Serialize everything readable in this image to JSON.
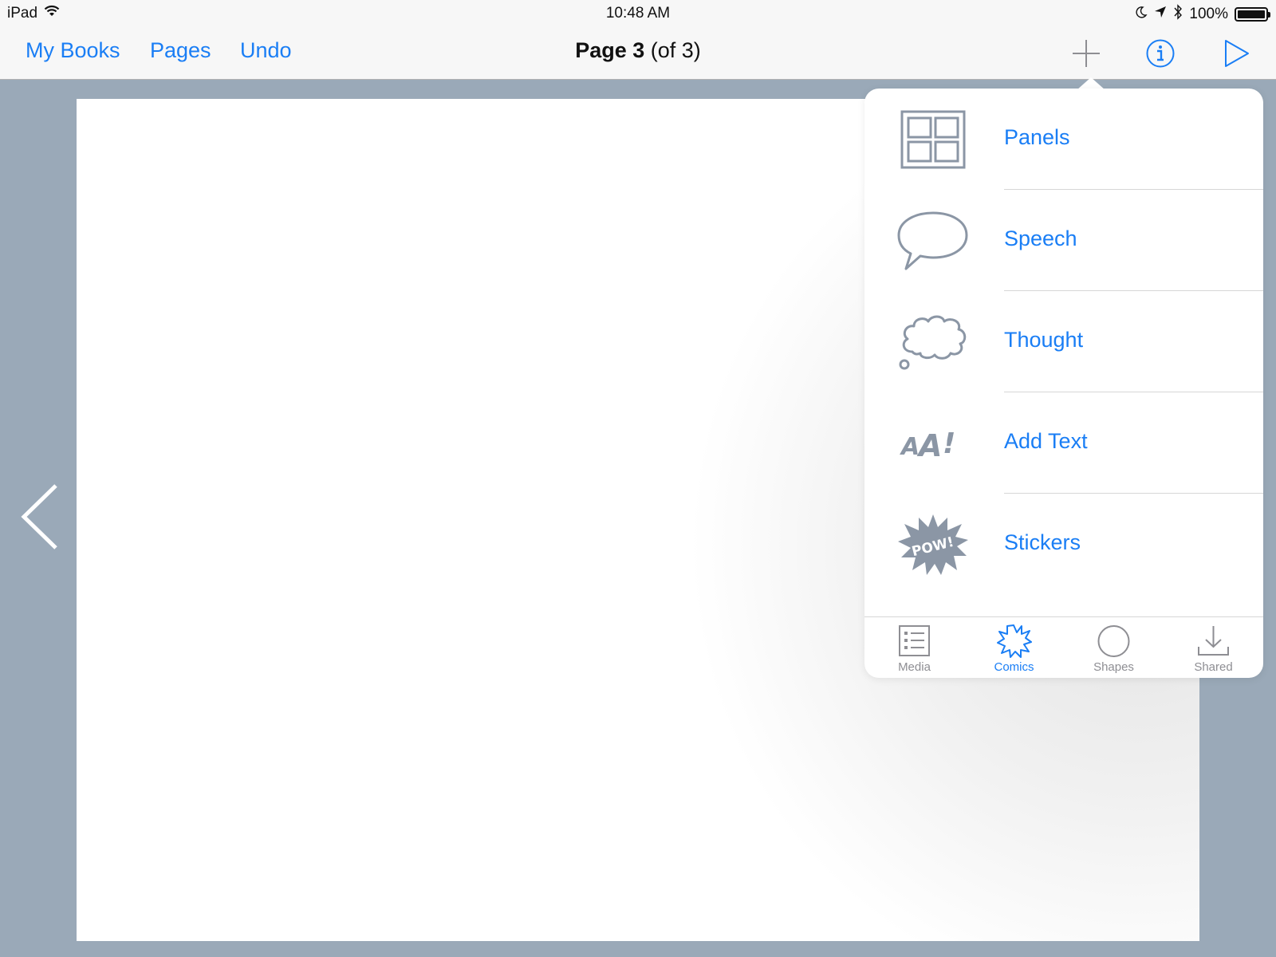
{
  "status_bar": {
    "device": "iPad",
    "time": "10:48 AM",
    "battery": "100%",
    "battery_level": 1.0,
    "icons": [
      "wifi-icon",
      "moon-icon",
      "location-arrow-icon",
      "bluetooth-icon",
      "battery-icon"
    ]
  },
  "nav": {
    "my_books": "My Books",
    "pages": "Pages",
    "undo": "Undo",
    "title_bold": "Page 3",
    "title_rest": " (of 3)",
    "icons": [
      "add-icon",
      "info-icon",
      "play-icon"
    ]
  },
  "popover": {
    "items": [
      {
        "label": "Panels",
        "icon": "panels-icon"
      },
      {
        "label": "Speech",
        "icon": "speech-bubble-icon"
      },
      {
        "label": "Thought",
        "icon": "thought-bubble-icon"
      },
      {
        "label": "Add Text",
        "icon": "comic-text-icon"
      },
      {
        "label": "Stickers",
        "icon": "pow-sticker-icon"
      }
    ],
    "tabs": [
      {
        "label": "Media",
        "icon": "media-list-icon",
        "active": false
      },
      {
        "label": "Comics",
        "icon": "comics-burst-icon",
        "active": true
      },
      {
        "label": "Shapes",
        "icon": "circle-shape-icon",
        "active": false
      },
      {
        "label": "Shared",
        "icon": "download-tray-icon",
        "active": false
      }
    ]
  },
  "colors": {
    "accent": "#1a7ef5",
    "icon_gray": "#8b96a5",
    "background": "#9aa9b8"
  }
}
